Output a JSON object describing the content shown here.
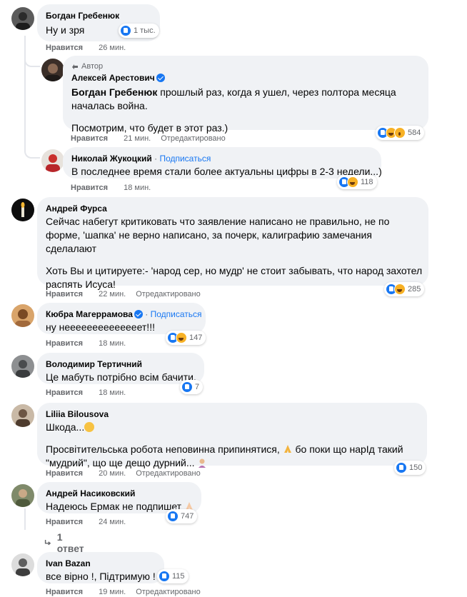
{
  "comments": [
    {
      "name": "Богдан Гребенюк",
      "lines": [
        "Ну и зря"
      ],
      "reaction_count": "1 тыс.",
      "like_label": "Нравится",
      "time": "26 мин."
    },
    {
      "author_badge": "Автор",
      "name": "Алексей Арестович",
      "mention": "Богдан Гребенюк",
      "line1_rest": " прошлый раз, когда я ушел, через полтора месяца",
      "line2": "началась война.",
      "line3": "Посмотрим, что будет в этот раз.)",
      "reaction_count": "584",
      "like_label": "Нравится",
      "time": "21 мин.",
      "edited": "Отредактировано"
    },
    {
      "name": "Николай Жукоцкий",
      "dot": " · ",
      "follow": "Подписаться",
      "lines": [
        "В последнее время стали более актуальны цифры в 2-3 недели...)"
      ],
      "reaction_count": "118",
      "like_label": "Нравится",
      "time": "18 мин."
    },
    {
      "name": "Андрей Фурса",
      "lines": [
        "Сейчас набегут критиковать что заявление написано не правильно, не по",
        "форме, 'шапка' не верно написано, за почерк, калиграфию замечания",
        "сделалают"
      ],
      "lines2": [
        "Хоть Вы и цитируете:- 'народ сер, но мудр' не стоит забывать, что народ захотел",
        "распять Исуса!"
      ],
      "reaction_count": "285",
      "like_label": "Нравится",
      "time": "22 мин.",
      "edited": "Отредактировано"
    },
    {
      "name": "Кюбра Магеррамова",
      "dot": " · ",
      "follow": "Подписаться",
      "lines": [
        "ну неееееееееееееет!!!"
      ],
      "reaction_count": "147",
      "like_label": "Нравится",
      "time": "18 мин."
    },
    {
      "name": "Володимир Тертичний",
      "lines": [
        "Це мабуть потрібно всім бачити."
      ],
      "reaction_count": "7",
      "like_label": "Нравится",
      "time": "18 мин."
    },
    {
      "name": "Liliia Bilousova",
      "line1": "Шкода...",
      "line2a": "Просвітительська робота неповинна припинятися, ",
      "line2b": " бо поки що нарІд такий",
      "line3": "\"мудрий\", що ще дещо дурний... ",
      "reaction_count": "150",
      "like_label": "Нравится",
      "time": "20 мин.",
      "edited": "Отредактировано"
    },
    {
      "name": "Андрей Насиковский",
      "line1": "Надеюсь Ермак не подпишет ",
      "reaction_count": "747",
      "like_label": "Нравится",
      "time": "24 мин.",
      "replies": "1 ответ"
    },
    {
      "name": "Ivan Bazan",
      "lines": [
        "все вірно !, Підтримую !"
      ],
      "reaction_count": "115",
      "like_label": "Нравится",
      "time": "19 мин.",
      "edited": "Отредактировано"
    }
  ],
  "icons": {
    "like": "like-reaction-icon",
    "haha": "haha-reaction-icon",
    "wow": "wow-reaction-icon",
    "verified": "verified-badge-icon",
    "reply_arrow": "reply-arrow-icon"
  },
  "colors": {
    "bubble": "#f0f2f5",
    "link_blue": "#1877f2",
    "meta_gray": "#65676b"
  }
}
